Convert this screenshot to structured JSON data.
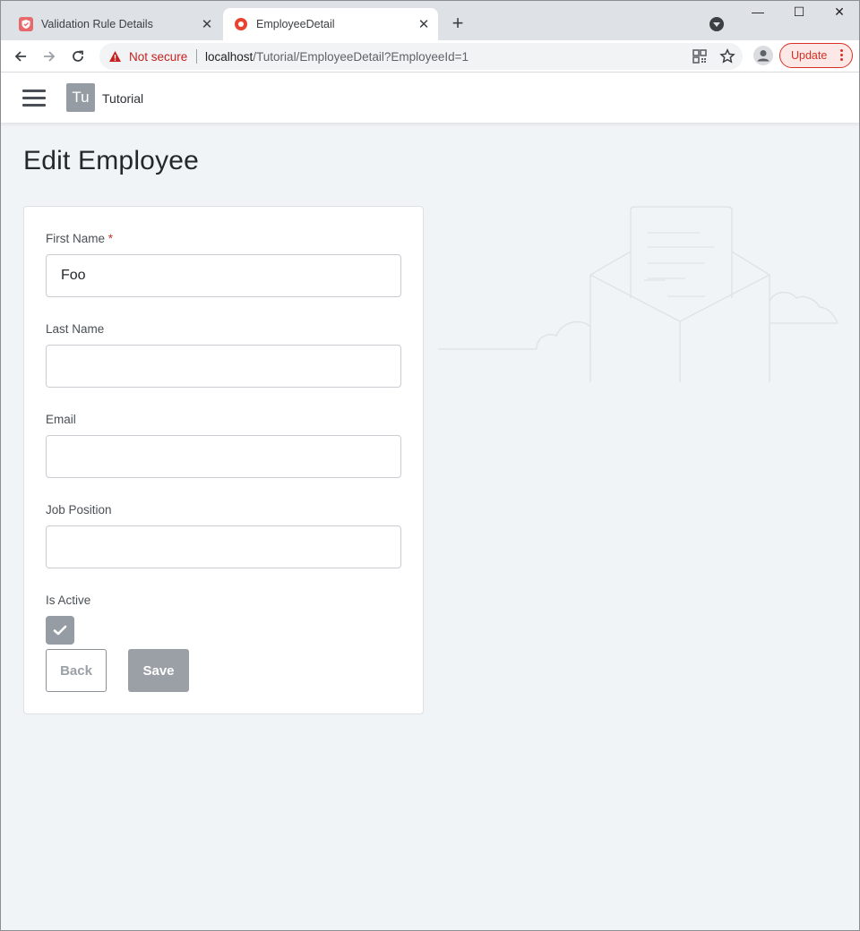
{
  "browser": {
    "tabs": [
      {
        "title": "Validation Rule Details",
        "active": false
      },
      {
        "title": "EmployeeDetail",
        "active": true
      }
    ],
    "security_label": "Not secure",
    "url_host": "localhost",
    "url_path": "/Tutorial/EmployeeDetail?EmployeeId=1",
    "update_label": "Update"
  },
  "app": {
    "avatar_text": "Tu",
    "name": "Tutorial"
  },
  "page": {
    "title": "Edit Employee"
  },
  "form": {
    "first_name": {
      "label": "First Name",
      "required_mark": "*",
      "value": "Foo"
    },
    "last_name": {
      "label": "Last Name",
      "value": ""
    },
    "email": {
      "label": "Email",
      "value": ""
    },
    "job_position": {
      "label": "Job Position",
      "value": ""
    },
    "is_active": {
      "label": "Is Active",
      "checked": true
    },
    "back_label": "Back",
    "save_label": "Save"
  },
  "colors": {
    "accent_gray": "#969ca3",
    "warning_red": "#c5221f",
    "page_background": "#f1f4f7"
  }
}
